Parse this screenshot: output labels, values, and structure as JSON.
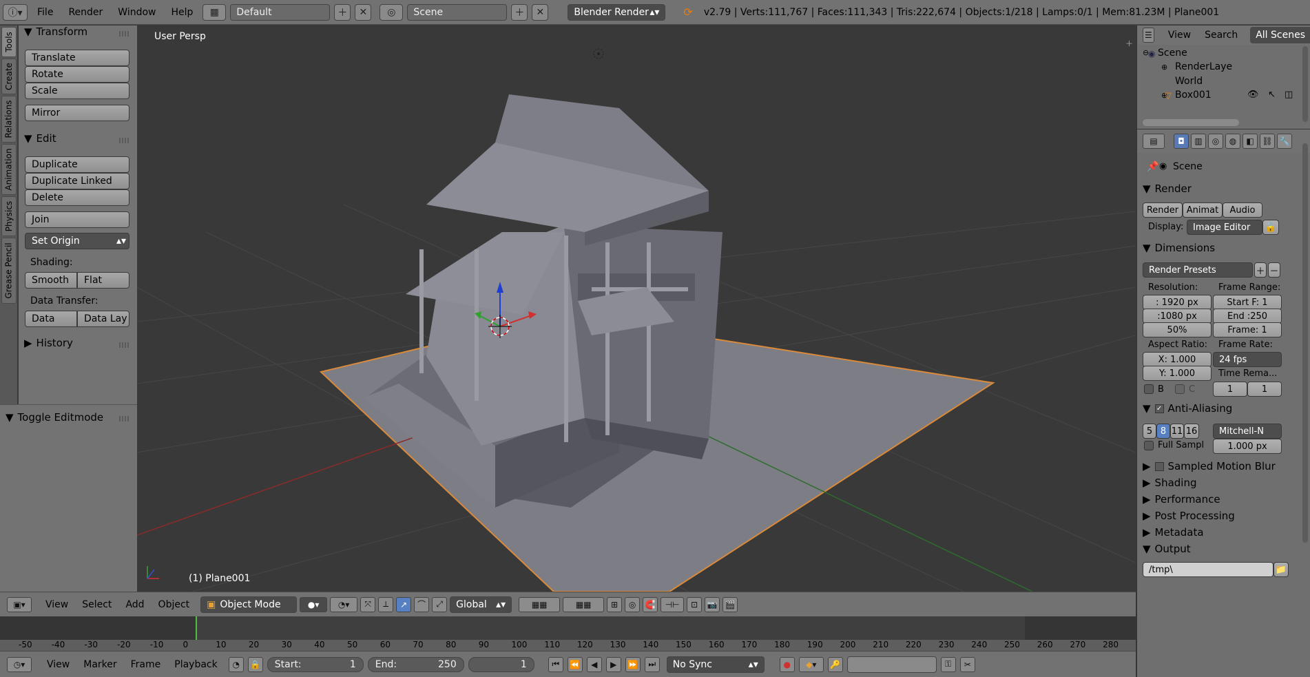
{
  "topbar": {
    "menus": [
      "File",
      "Render",
      "Window",
      "Help"
    ],
    "layout": "Default",
    "scene": "Scene",
    "engine": "Blender Render",
    "stats": "v2.79 | Verts:111,767 | Faces:111,343 | Tris:222,674 | Objects:1/218 | Lamps:0/1 | Mem:81.23M | Plane001"
  },
  "tabs": [
    "Tools",
    "Create",
    "Relations",
    "Animation",
    "Physics",
    "Grease Pencil"
  ],
  "tools": {
    "transform": "Transform",
    "translate": "Translate",
    "rotate": "Rotate",
    "scale": "Scale",
    "mirror": "Mirror",
    "edit": "Edit",
    "duplicate": "Duplicate",
    "duplicate_linked": "Duplicate Linked",
    "delete": "Delete",
    "join": "Join",
    "set_origin": "Set Origin",
    "shading": "Shading:",
    "smooth": "Smooth",
    "flat": "Flat",
    "data_transfer": "Data Transfer:",
    "data": "Data",
    "data_lay": "Data Lay",
    "history": "History"
  },
  "operator": "Toggle Editmode",
  "viewport": {
    "persp": "User Persp",
    "object_name": "(1) Plane001"
  },
  "outliner": {
    "view": "View",
    "search": "Search",
    "all_scenes": "All Scenes",
    "items": [
      "Scene",
      "RenderLaye",
      "World",
      "Box001"
    ]
  },
  "props": {
    "scene": "Scene",
    "render": "Render",
    "render_btn": "Render",
    "anim_btn": "Animat",
    "audio_btn": "Audio",
    "display_label": "Display:",
    "display_value": "Image Editor",
    "dimensions": "Dimensions",
    "presets": "Render Presets",
    "resolution": "Resolution:",
    "res_x": ": 1920 px",
    "res_y": ":1080 px",
    "res_pct": "50%",
    "frame_range": "Frame Range:",
    "start": "Start F: 1",
    "end": "End :250",
    "frame": "Frame: 1",
    "aspect": "Aspect Ratio:",
    "ax": "X:  1.000",
    "ay": "Y:  1.000",
    "frame_rate": "Frame Rate:",
    "fps": "24 fps",
    "time_remap": "Time Rema...",
    "remap_a": "1",
    "remap_b": "1",
    "b": "B",
    "c": "C",
    "aa": "Anti-Aliasing",
    "aa_levels": [
      "5",
      "8",
      "11",
      "16"
    ],
    "filter": "Mitchell-N",
    "full_sample": "Full Sampl",
    "filter_size": "1.000 px",
    "sampled_blur": "Sampled Motion Blur",
    "shading": "Shading",
    "performance": "Performance",
    "post": "Post Processing",
    "metadata": "Metadata",
    "output": "Output",
    "output_path": "/tmp\\"
  },
  "vpheader": {
    "view": "View",
    "select": "Select",
    "add": "Add",
    "object": "Object",
    "mode": "Object Mode",
    "orientation": "Global"
  },
  "timeline": {
    "ticks": [
      "-50",
      "-40",
      "-30",
      "-20",
      "-10",
      "0",
      "10",
      "20",
      "30",
      "40",
      "50",
      "60",
      "70",
      "80",
      "90",
      "100",
      "110",
      "120",
      "130",
      "140",
      "150",
      "160",
      "170",
      "180",
      "190",
      "200",
      "210",
      "220",
      "230",
      "240",
      "250",
      "260",
      "270",
      "280"
    ]
  },
  "tlheader": {
    "view": "View",
    "marker": "Marker",
    "frame": "Frame",
    "playback": "Playback",
    "start": "Start:",
    "start_val": "1",
    "end": "End:",
    "end_val": "250",
    "current": "1",
    "sync": "No Sync"
  }
}
